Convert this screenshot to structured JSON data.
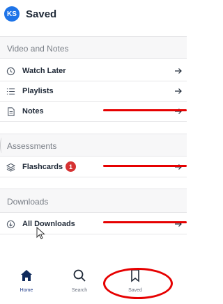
{
  "header": {
    "avatar_initials": "KS",
    "title": "Saved"
  },
  "sections": {
    "video_notes": {
      "heading": "Video and Notes",
      "items": [
        {
          "label": "Watch Later",
          "icon": "clock-icon"
        },
        {
          "label": "Playlists",
          "icon": "list-icon"
        },
        {
          "label": "Notes",
          "icon": "document-icon"
        }
      ]
    },
    "assessments": {
      "heading": "Assessments",
      "items": [
        {
          "label": "Flashcards",
          "icon": "stack-icon",
          "badge": "1"
        }
      ]
    },
    "downloads": {
      "heading": "Downloads",
      "items": [
        {
          "label": "All Downloads",
          "icon": "download-circle-icon"
        }
      ]
    }
  },
  "tabs": [
    {
      "label": "Home",
      "icon": "home-icon",
      "active": true
    },
    {
      "label": "Search",
      "icon": "search-icon",
      "active": false
    },
    {
      "label": "Saved",
      "icon": "bookmark-icon",
      "active": false
    }
  ],
  "colors": {
    "accent": "#1e74e8",
    "badge": "#d63232",
    "annotation": "#e60000"
  }
}
